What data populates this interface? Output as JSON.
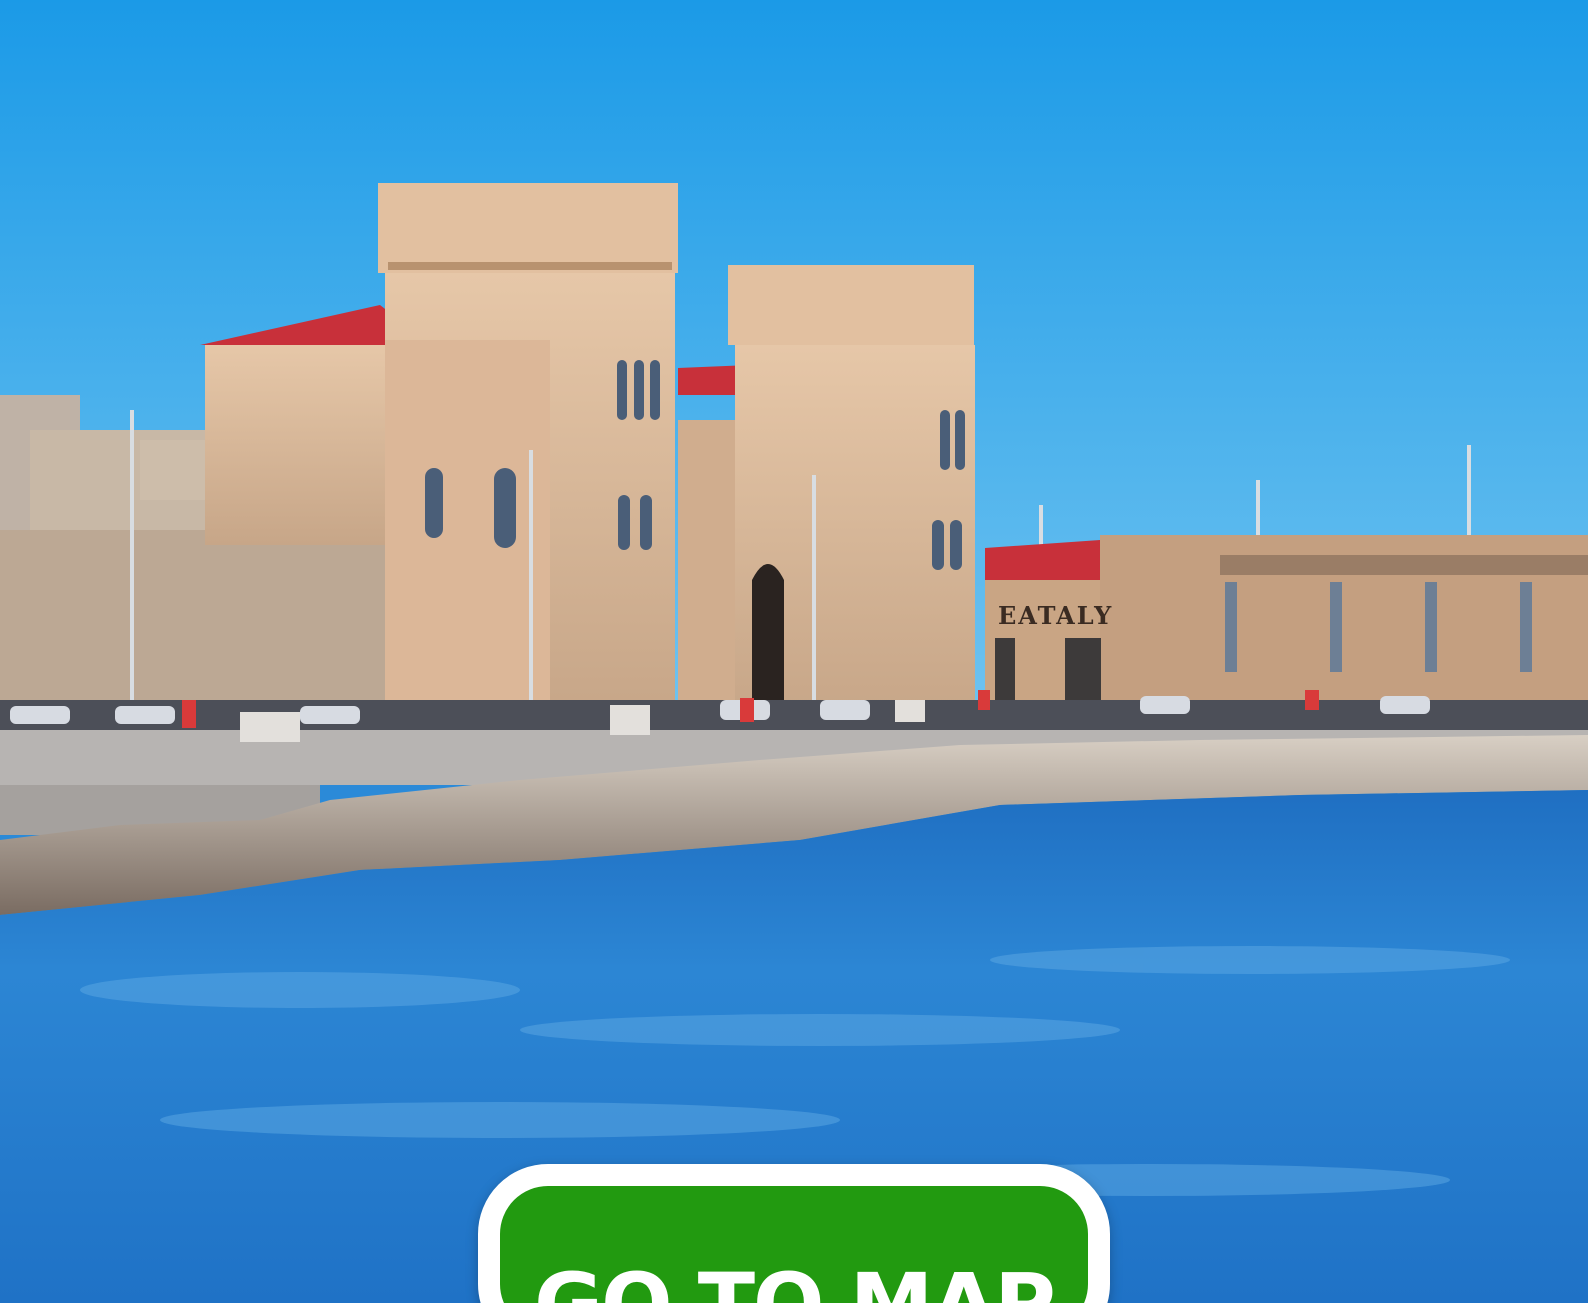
{
  "photo": {
    "storefront_sign": "EATALY"
  },
  "cta": {
    "label": "GO TO MAP"
  },
  "colors": {
    "sky": "#1d9be6",
    "sea": "#2a7fd0",
    "stone": "#d9b89a",
    "roof": "#c8303a",
    "button_green": "#229a10",
    "button_border": "#ffffff"
  }
}
